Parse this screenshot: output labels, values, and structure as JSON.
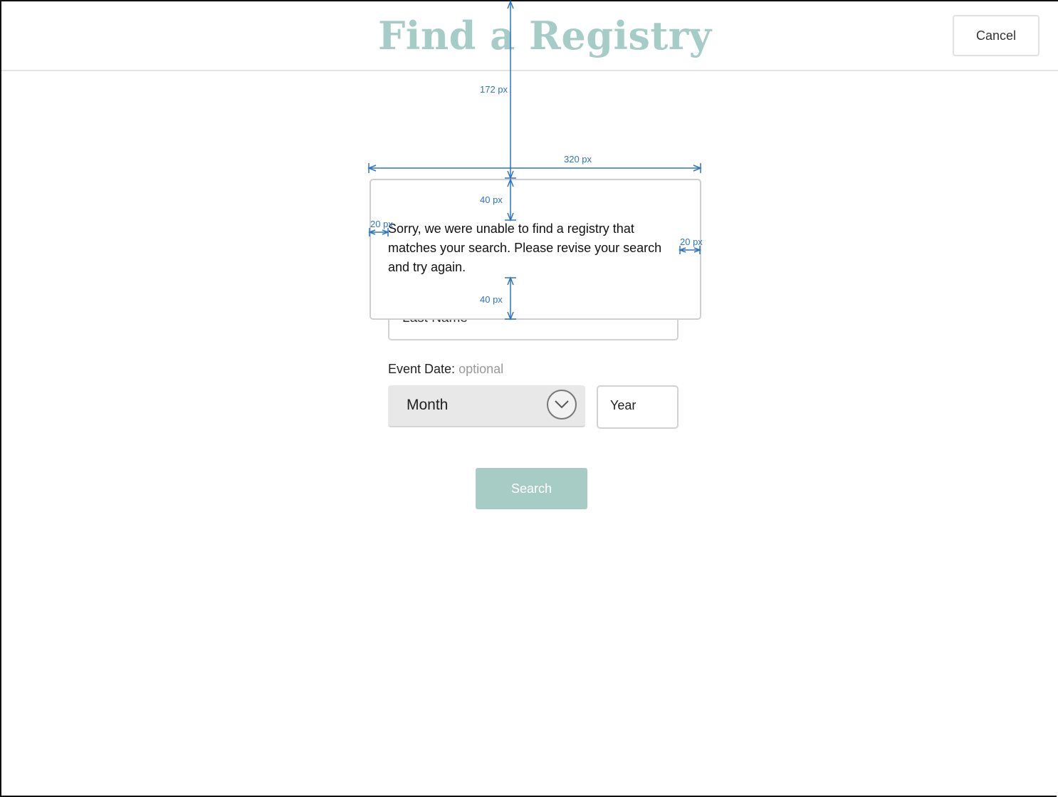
{
  "header": {
    "title": "Find a Registry",
    "cancel_label": "Cancel"
  },
  "form": {
    "last_name_text": "Last Name",
    "event_date_label": "Event Date:",
    "event_date_optional": "optional",
    "month_value": "Month",
    "year_value": "Year",
    "search_label": "Search"
  },
  "error": {
    "message": "Sorry, we were unable to find a registry that matches your search. Please revise your search and try again."
  },
  "annotations": {
    "top_offset": "172 px",
    "box_width": "320 px",
    "padding_top": "40 px",
    "padding_bottom": "40 px",
    "padding_left": "20 px",
    "padding_right": "20 px"
  },
  "colors": {
    "accent": "#a5ccc6",
    "button": "#a7cbc5",
    "annotation": "#2f73c0"
  },
  "icons": {
    "month_dropdown": "chevron-down-icon"
  }
}
